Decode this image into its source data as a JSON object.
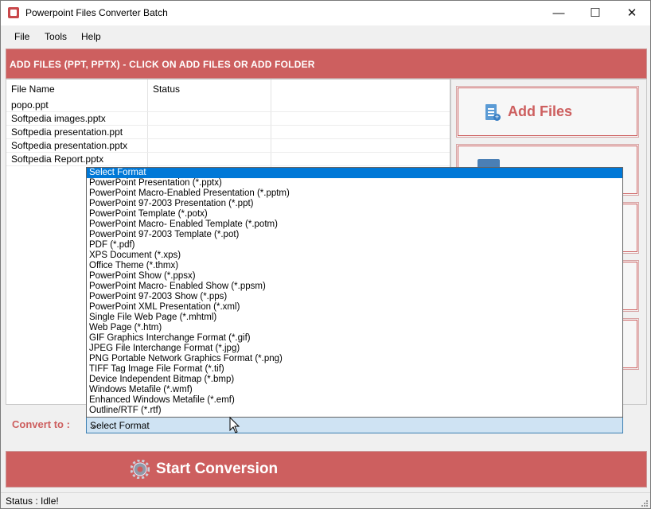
{
  "window": {
    "title": "Powerpoint Files Converter Batch",
    "controls": {
      "minimize": "—",
      "maximize": "☐",
      "close": "✕"
    }
  },
  "menu": [
    "File",
    "Tools",
    "Help"
  ],
  "banner": "ADD FILES (PPT, PPTX) - CLICK ON ADD FILES OR ADD FOLDER",
  "file_list": {
    "columns": [
      "File Name",
      "Status"
    ],
    "rows": [
      {
        "name": "popo.ppt",
        "status": ""
      },
      {
        "name": "Softpedia images.pptx",
        "status": ""
      },
      {
        "name": "Softpedia presentation.ppt",
        "status": ""
      },
      {
        "name": "Softpedia presentation.pptx",
        "status": ""
      },
      {
        "name": "Softpedia Report.pptx",
        "status": ""
      }
    ]
  },
  "right_panel": {
    "add_files_label": "Add Files"
  },
  "convert": {
    "label": "Convert to :",
    "selected": "Select Format",
    "options": [
      "Select Format",
      "PowerPoint Presentation (*.pptx)",
      "PowerPoint Macro-Enabled Presentation (*.pptm)",
      "PowerPoint 97-2003 Presentation (*.ppt)",
      "PowerPoint Template (*.potx)",
      "PowerPoint Macro- Enabled Template (*.potm)",
      "PowerPoint 97-2003 Template (*.pot)",
      "PDF (*.pdf)",
      "XPS Document (*.xps)",
      "Office Theme (*.thmx)",
      "PowerPoint Show (*.ppsx)",
      "PowerPoint Macro- Enabled Show (*.ppsm)",
      "PowerPoint 97-2003 Show (*.pps)",
      "PowerPoint XML Presentation (*.xml)",
      "Single File Web Page (*.mhtml)",
      "Web Page (*.htm)",
      "GIF Graphics Interchange Format (*.gif)",
      "JPEG File Interchange Format (*.jpg)",
      "PNG Portable Network Graphics Format (*.png)",
      "TIFF Tag Image File Format (*.tif)",
      "Device Independent Bitmap (*.bmp)",
      "Windows Metafile (*.wmf)",
      "Enhanced Windows Metafile (*.emf)",
      "Outline/RTF (*.rtf)"
    ]
  },
  "start_button": "Start Conversion",
  "status": "Status  :  Idle!",
  "colors": {
    "accent": "#cd5f5f",
    "selection": "#0078d7"
  }
}
